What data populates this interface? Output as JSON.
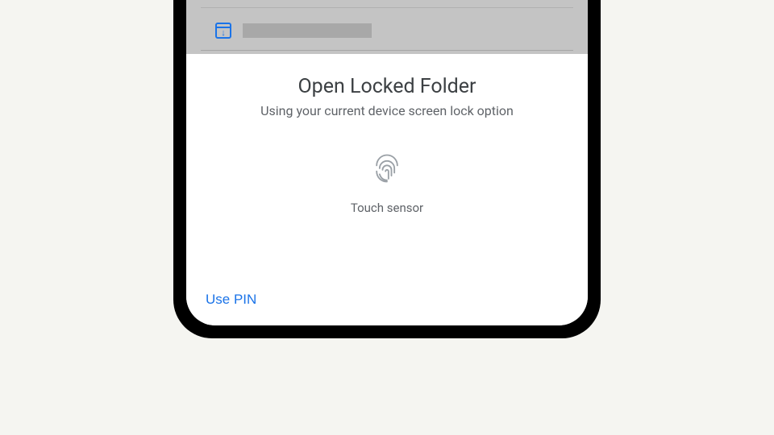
{
  "dialog": {
    "title": "Open Locked Folder",
    "subtitle": "Using your current device screen lock option",
    "sensor_label": "Touch sensor",
    "use_pin_label": "Use PIN"
  },
  "icons": {
    "archive": "archive-box-icon",
    "fingerprint": "fingerprint-icon"
  },
  "colors": {
    "accent": "#1a73e8",
    "text_primary": "#3c4043",
    "text_secondary": "#5f6368",
    "greyed_bg": "#c4c4c4"
  }
}
